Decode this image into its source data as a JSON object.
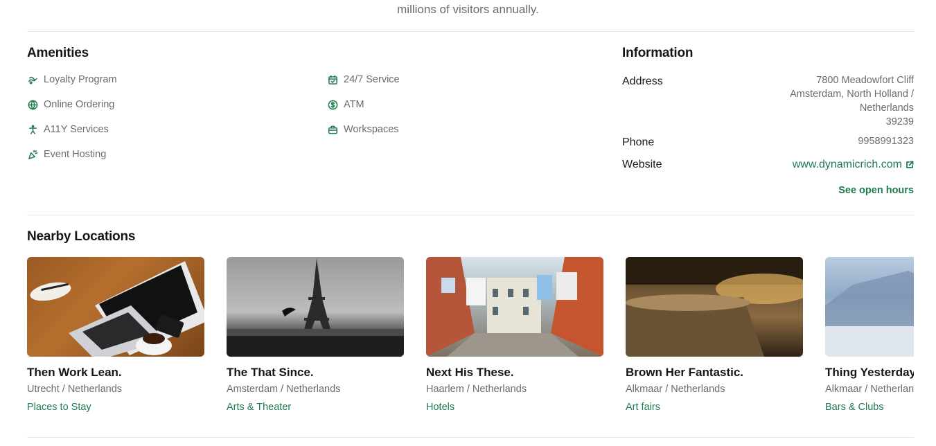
{
  "intro_text": "millions of visitors annually.",
  "amenities": {
    "heading": "Amenities",
    "items": [
      {
        "label": "Loyalty Program",
        "icon": "loyalty-icon"
      },
      {
        "label": "Online Ordering",
        "icon": "globe-icon"
      },
      {
        "label": "A11Y Services",
        "icon": "accessibility-icon"
      },
      {
        "label": "Event Hosting",
        "icon": "party-popper-icon"
      },
      {
        "label": "24/7 Service",
        "icon": "calendar-check-icon"
      },
      {
        "label": "ATM",
        "icon": "dollar-circle-icon"
      },
      {
        "label": "Workspaces",
        "icon": "briefcase-icon"
      }
    ]
  },
  "information": {
    "heading": "Information",
    "address_label": "Address",
    "address_lines": [
      "7800 Meadowfort Cliff",
      "Amsterdam, North Holland /",
      "Netherlands",
      "39239"
    ],
    "phone_label": "Phone",
    "phone_value": "9958991323",
    "website_label": "Website",
    "website_value": "www.dynamicrich.com",
    "open_hours_link": "See open hours"
  },
  "nearby": {
    "heading": "Nearby Locations",
    "cards": [
      {
        "title": "Then Work Lean.",
        "location": "Utrecht / Netherlands",
        "category": "Places to Stay",
        "image": "laptop-on-desk"
      },
      {
        "title": "The That Since.",
        "location": "Amsterdam / Netherlands",
        "category": "Arts & Theater",
        "image": "eiffel-tower"
      },
      {
        "title": "Next His These.",
        "location": "Haarlem / Netherlands",
        "category": "Hotels",
        "image": "laundry-street"
      },
      {
        "title": "Brown Her Fantastic.",
        "location": "Alkmaar / Netherlands",
        "category": "Art fairs",
        "image": "tree-stump-sunset"
      },
      {
        "title": "Thing Yesterday.",
        "location": "Alkmaar / Netherlands",
        "category": "Bars & Clubs",
        "image": "misty-mountain"
      }
    ]
  },
  "colors": {
    "accent": "#1e7a4e",
    "muted_text": "#6b6b6b",
    "divider": "#e5e5e5"
  }
}
